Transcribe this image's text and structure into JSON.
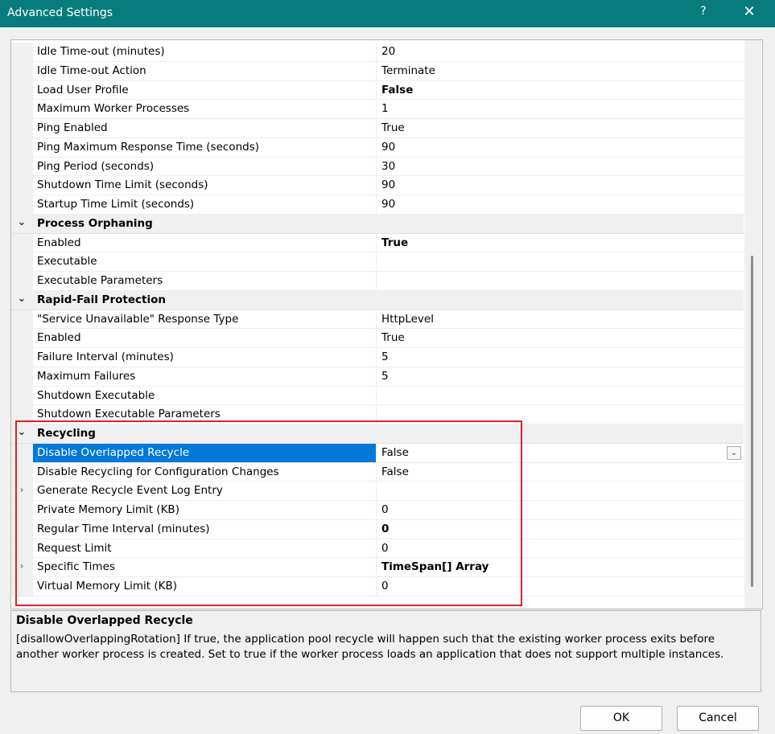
{
  "window": {
    "title": "Advanced Settings",
    "help": "?",
    "close": "✕"
  },
  "rows": [
    {
      "type": "prop",
      "name": "Idle Time-out (minutes)",
      "value": "20"
    },
    {
      "type": "prop",
      "name": "Idle Time-out Action",
      "value": "Terminate"
    },
    {
      "type": "prop",
      "name": "Load User Profile",
      "value": "False",
      "bold": true
    },
    {
      "type": "prop",
      "name": "Maximum Worker Processes",
      "value": "1"
    },
    {
      "type": "prop",
      "name": "Ping Enabled",
      "value": "True"
    },
    {
      "type": "prop",
      "name": "Ping Maximum Response Time (seconds)",
      "value": "90"
    },
    {
      "type": "prop",
      "name": "Ping Period (seconds)",
      "value": "30"
    },
    {
      "type": "prop",
      "name": "Shutdown Time Limit (seconds)",
      "value": "90"
    },
    {
      "type": "prop",
      "name": "Startup Time Limit (seconds)",
      "value": "90"
    },
    {
      "type": "cat",
      "name": "Process Orphaning"
    },
    {
      "type": "prop",
      "name": "Enabled",
      "value": "True",
      "bold": true
    },
    {
      "type": "prop",
      "name": "Executable",
      "value": ""
    },
    {
      "type": "prop",
      "name": "Executable Parameters",
      "value": ""
    },
    {
      "type": "cat",
      "name": "Rapid-Fail Protection"
    },
    {
      "type": "prop",
      "name": "\"Service Unavailable\" Response Type",
      "value": "HttpLevel"
    },
    {
      "type": "prop",
      "name": "Enabled",
      "value": "True"
    },
    {
      "type": "prop",
      "name": "Failure Interval (minutes)",
      "value": "5"
    },
    {
      "type": "prop",
      "name": "Maximum Failures",
      "value": "5"
    },
    {
      "type": "prop",
      "name": "Shutdown Executable",
      "value": ""
    },
    {
      "type": "prop",
      "name": "Shutdown Executable Parameters",
      "value": ""
    },
    {
      "type": "cat",
      "name": "Recycling"
    },
    {
      "type": "prop",
      "name": "Disable Overlapped Recycle",
      "value": "False",
      "selected": true,
      "dropdown": true
    },
    {
      "type": "prop",
      "name": "Disable Recycling for Configuration Changes",
      "value": "False"
    },
    {
      "type": "prop",
      "name": "Generate Recycle Event Log Entry",
      "value": "",
      "expandable": true
    },
    {
      "type": "prop",
      "name": "Private Memory Limit (KB)",
      "value": "0"
    },
    {
      "type": "prop",
      "name": "Regular Time Interval (minutes)",
      "value": "0",
      "bold": true
    },
    {
      "type": "prop",
      "name": "Request Limit",
      "value": "0"
    },
    {
      "type": "prop",
      "name": "Specific Times",
      "value": "TimeSpan[] Array",
      "bold": true,
      "expandable": true
    },
    {
      "type": "prop",
      "name": "Virtual Memory Limit (KB)",
      "value": "0"
    }
  ],
  "description": {
    "title": "Disable Overlapped Recycle",
    "text": "[disallowOverlappingRotation] If true, the application pool recycle will happen such that the existing worker process exits before another worker process is created.  Set to true if the worker process loads an application that does not support multiple instances."
  },
  "buttons": {
    "ok": "OK",
    "cancel": "Cancel"
  },
  "colors": {
    "titlebar": "#087c7d",
    "selection": "#0078d7",
    "highlight_box": "#e0202e"
  },
  "icons": {
    "category_expanded": "chevron-down-icon",
    "item_expandable": "chevron-right-icon",
    "dropdown": "chevron-down-icon"
  }
}
